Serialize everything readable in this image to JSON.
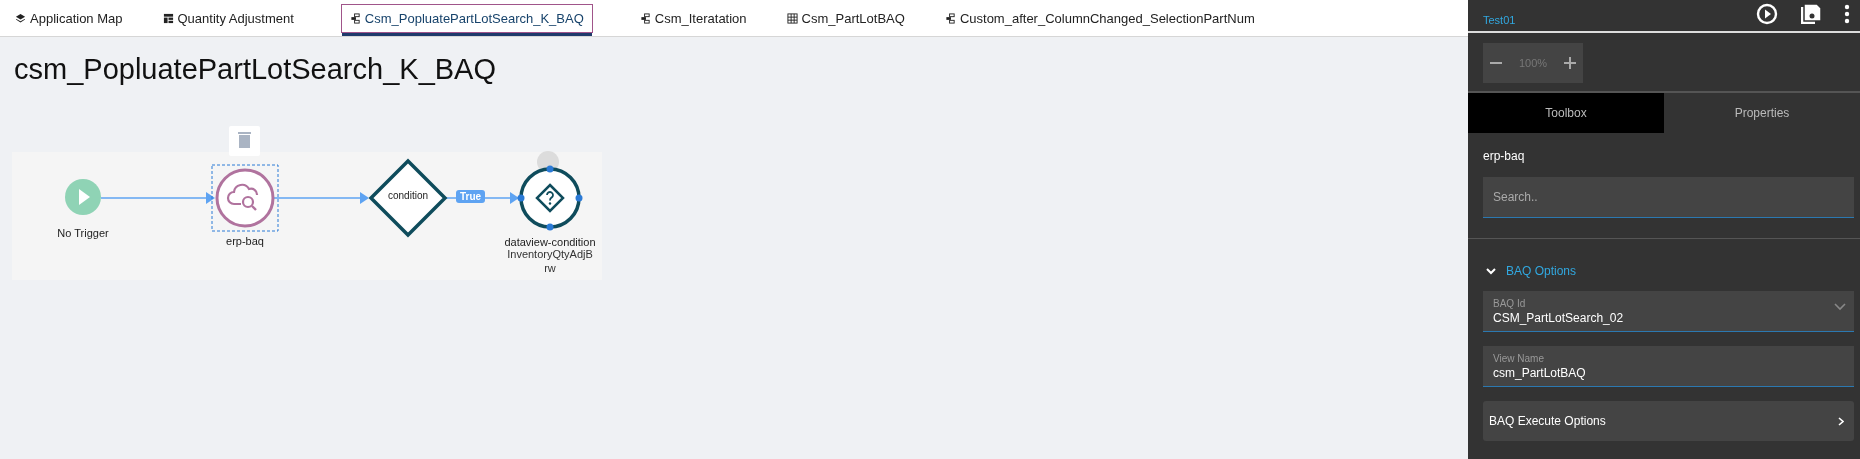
{
  "tabs": [
    {
      "label": "Application Map",
      "kind": "layers",
      "selected": false
    },
    {
      "label": "Quantity Adjustment",
      "kind": "table",
      "selected": false
    },
    {
      "label": "Csm_PopluatePartLotSearch_K_BAQ",
      "kind": "flow",
      "selected": true
    },
    {
      "label": "Csm_Iteratation",
      "kind": "flow",
      "selected": false
    },
    {
      "label": "Csm_PartLotBAQ",
      "kind": "grid",
      "selected": false
    },
    {
      "label": "Custom_after_ColumnChanged_SelectionPartNum",
      "kind": "flow",
      "selected": false
    }
  ],
  "canvas": {
    "title": "csm_PopluatePartLotSearch_K_BAQ",
    "nodes": [
      {
        "kind": "trigger",
        "label": "No Trigger",
        "selected": false
      },
      {
        "kind": "baq",
        "label": "erp-baq",
        "selected": true
      },
      {
        "kind": "condition",
        "label": "condition",
        "selected": false
      },
      {
        "kind": "dataview",
        "label": "dataview-condition",
        "sublabel": "InventoryQtyAdjBrw",
        "incoming_label": "True",
        "selected": false
      }
    ]
  },
  "panel": {
    "subtitle": "Test01",
    "zoom": "100%",
    "tabs": [
      {
        "label": "Toolbox",
        "selected": true
      },
      {
        "label": "Properties",
        "selected": false
      }
    ],
    "section": "erp-baq",
    "search": {
      "placeholder": "Search.."
    },
    "group": {
      "title": "BAQ Options",
      "expanded": true
    },
    "fields": [
      {
        "kind": "select",
        "label": "BAQ Id",
        "value": "CSM_PartLotSearch_02"
      },
      {
        "kind": "text",
        "label": "View Name",
        "value": "csm_PartLotBAQ"
      }
    ],
    "collapsed": {
      "title": "BAQ Execute Options"
    }
  }
}
